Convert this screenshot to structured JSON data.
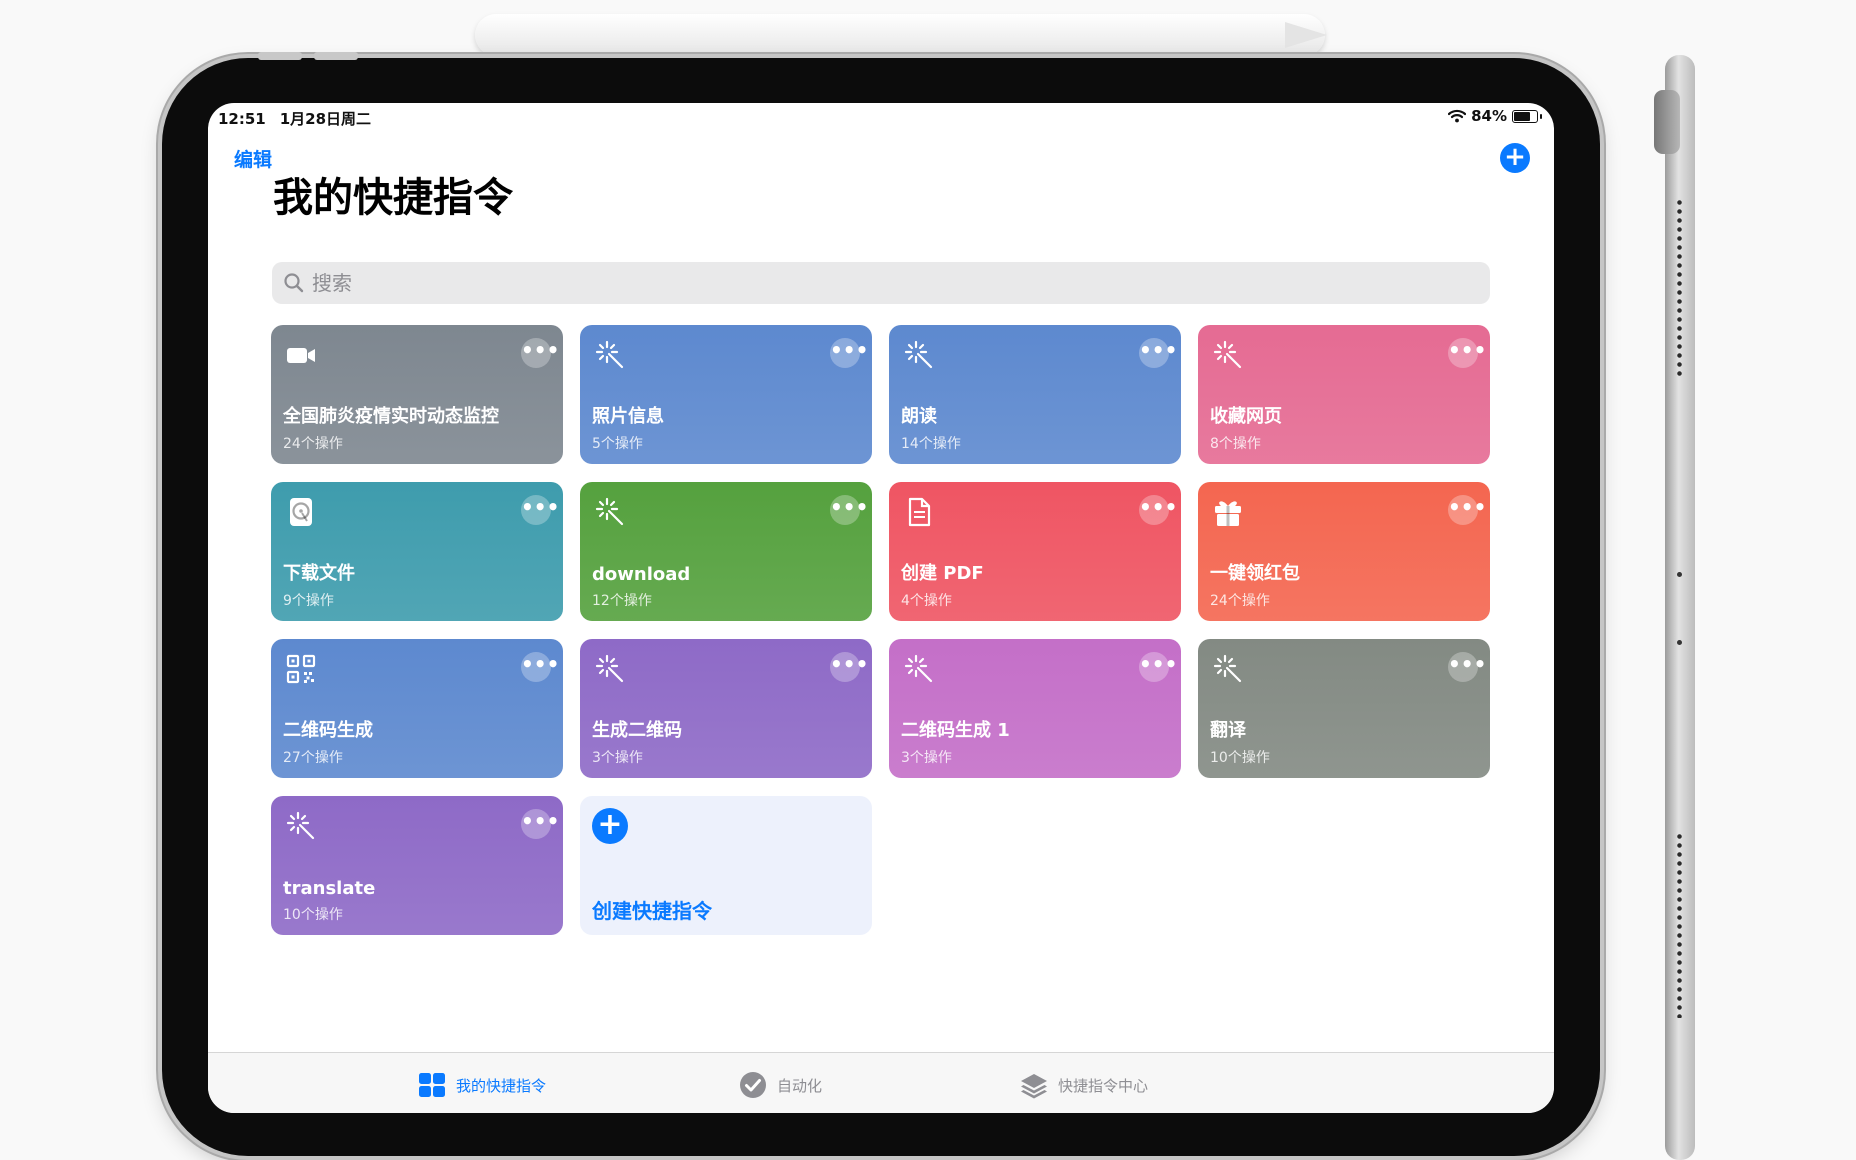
{
  "status_bar": {
    "time": "12:51",
    "date": "1月28日周二",
    "battery": "84%",
    "battery_level": 0.84
  },
  "nav": {
    "edit_label": "编辑",
    "add_icon": "plus-icon"
  },
  "page_title": "我的快捷指令",
  "search": {
    "placeholder": "搜索"
  },
  "shortcuts": [
    {
      "title": "全国肺炎疫情实时动态监控",
      "actions": "24个操作",
      "icon": "video-camera-icon",
      "color": "#7e8790"
    },
    {
      "title": "照片信息",
      "actions": "5个操作",
      "icon": "magic-wand-icon",
      "color": "#5d89cf"
    },
    {
      "title": "朗读",
      "actions": "14个操作",
      "icon": "magic-wand-icon",
      "color": "#5d89cf"
    },
    {
      "title": "收藏网页",
      "actions": "8个操作",
      "icon": "magic-wand-icon",
      "color": "#e56b93"
    },
    {
      "title": "下载文件",
      "actions": "9个操作",
      "icon": "hard-drive-icon",
      "color": "#3e9cad"
    },
    {
      "title": "download",
      "actions": "12个操作",
      "icon": "magic-wand-icon",
      "color": "#55a13e"
    },
    {
      "title": "创建 PDF",
      "actions": "4个操作",
      "icon": "document-icon",
      "color": "#ef5563"
    },
    {
      "title": "一键领红包",
      "actions": "24个操作",
      "icon": "gift-icon",
      "color": "#f46650"
    },
    {
      "title": "二维码生成",
      "actions": "27个操作",
      "icon": "qr-code-icon",
      "color": "#5d89cf"
    },
    {
      "title": "生成二维码",
      "actions": "3个操作",
      "icon": "magic-wand-icon",
      "color": "#8e6ac7"
    },
    {
      "title": "二维码生成 1",
      "actions": "3个操作",
      "icon": "magic-wand-icon",
      "color": "#c46fc8"
    },
    {
      "title": "翻译",
      "actions": "10个操作",
      "icon": "magic-wand-icon",
      "color": "#838a83"
    },
    {
      "title": "translate",
      "actions": "10个操作",
      "icon": "magic-wand-icon",
      "color": "#8e6ac7"
    }
  ],
  "create_card": {
    "label": "创建快捷指令"
  },
  "tabs": [
    {
      "label": "我的快捷指令",
      "icon": "grid-icon",
      "active": true
    },
    {
      "label": "自动化",
      "icon": "checkmark-circle-icon",
      "active": false
    },
    {
      "label": "快捷指令中心",
      "icon": "layers-icon",
      "active": false
    }
  ],
  "colors": {
    "accent": "#0a7aff",
    "create_card_bg": "#edf1fc",
    "tab_inactive": "#8e8e93"
  }
}
